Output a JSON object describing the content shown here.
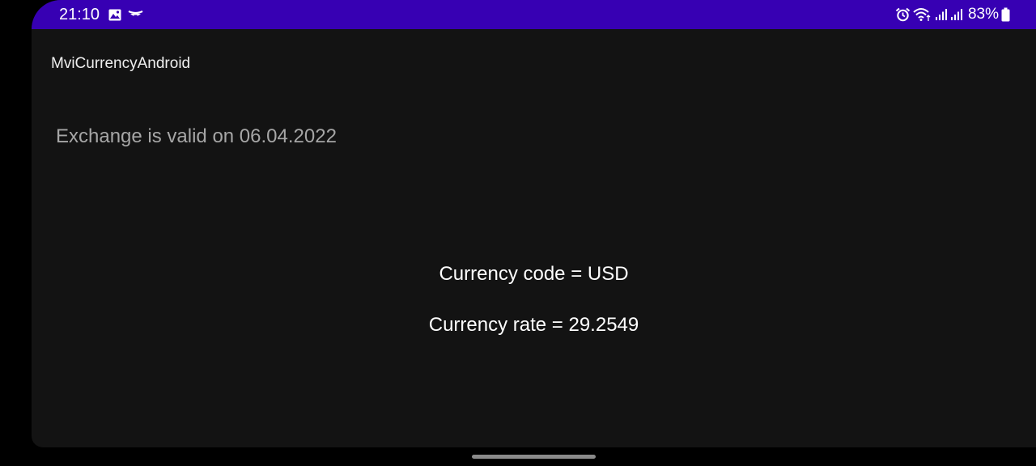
{
  "status_bar": {
    "time": "21:10",
    "left_icons": [
      "image-icon",
      "notification-icon"
    ],
    "right_icons": [
      "alarm-icon",
      "wifi-icon",
      "signal-icon",
      "signal-icon",
      "battery-icon"
    ],
    "battery_percent": "83%",
    "background_color": "#3700b3"
  },
  "app_bar": {
    "title": "MviCurrencyAndroid"
  },
  "main": {
    "valid_date_text": "Exchange is valid on 06.04.2022",
    "currency_code_text": "Currency code = USD",
    "currency_rate_text": "Currency rate = 29.2549"
  },
  "colors": {
    "background": "#131313",
    "accent": "#3700b3",
    "primary_text": "#ffffff",
    "secondary_text": "#a6a6a6"
  }
}
